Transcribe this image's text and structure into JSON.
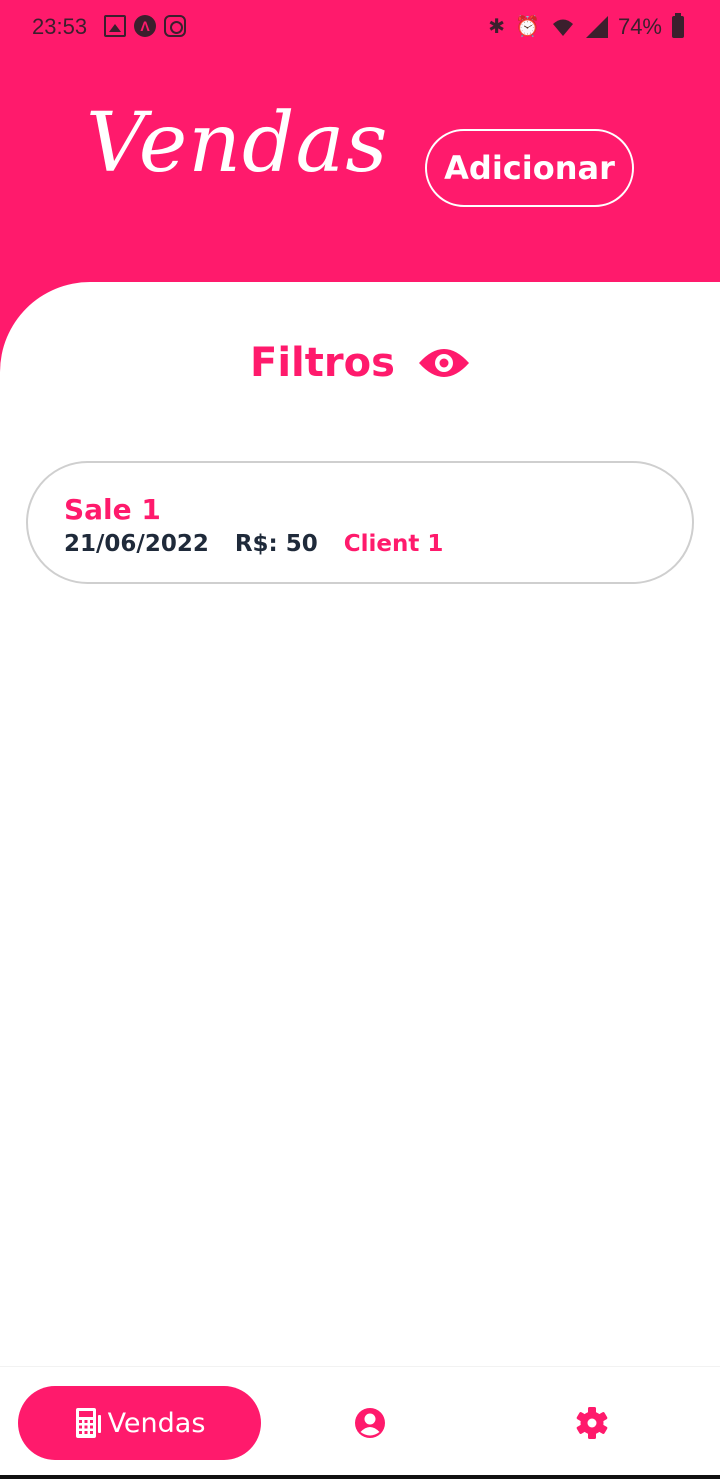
{
  "status_bar": {
    "time": "23:53",
    "battery": "74%",
    "left_icons": [
      "gallery-icon",
      "app-a-icon",
      "instagram-icon"
    ],
    "right_icons": [
      "bluetooth-icon",
      "alarm-icon",
      "wifi-icon",
      "signal-icon",
      "battery-icon"
    ]
  },
  "header": {
    "title": "Vendas",
    "add_label": "Adicionar"
  },
  "filters": {
    "label": "Filtros",
    "icon": "eye-icon"
  },
  "sales": [
    {
      "name": "Sale 1",
      "date": "21/06/2022",
      "price": "R$: 50",
      "client": "Client 1"
    }
  ],
  "nav": {
    "active_label": "Vendas",
    "active_icon": "calculator-icon",
    "items": [
      "vendas",
      "profile",
      "settings"
    ]
  },
  "colors": {
    "accent": "#FF1A6C",
    "text_dark": "#1f2a3a",
    "background": "#ffffff"
  }
}
